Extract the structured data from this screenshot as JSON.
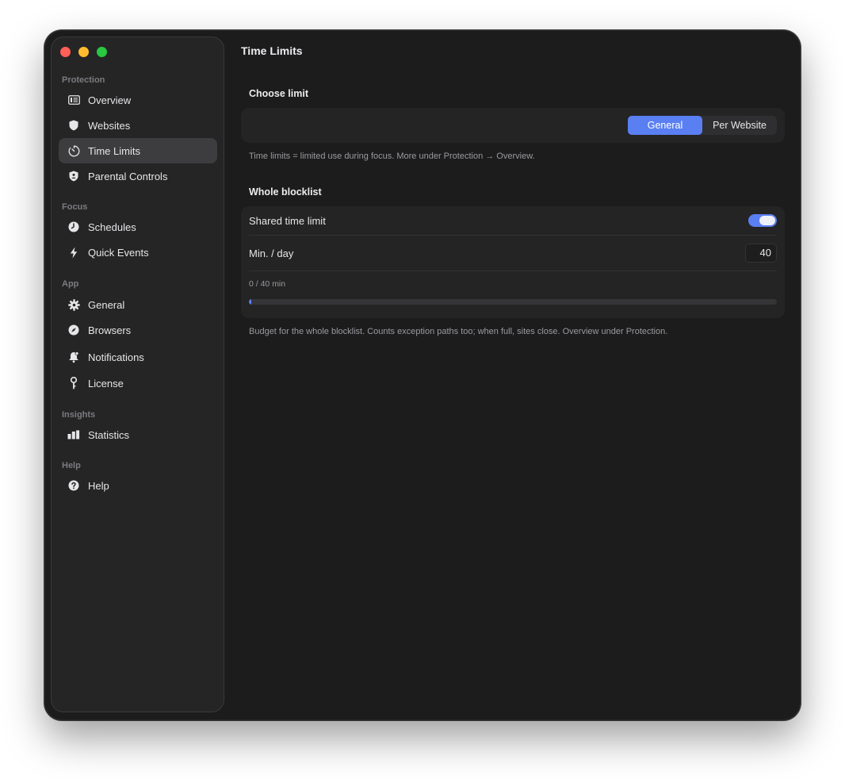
{
  "window": {
    "title": "Time Limits"
  },
  "sidebar": {
    "sections": [
      {
        "label": "Protection",
        "items": [
          {
            "label": "Overview",
            "icon": "overview-icon"
          },
          {
            "label": "Websites",
            "icon": "shield-icon"
          },
          {
            "label": "Time Limits",
            "icon": "timer-icon",
            "selected": true
          },
          {
            "label": "Parental Controls",
            "icon": "parental-shield-icon"
          }
        ]
      },
      {
        "label": "Focus",
        "items": [
          {
            "label": "Schedules",
            "icon": "clock-icon"
          },
          {
            "label": "Quick Events",
            "icon": "bolt-icon"
          }
        ]
      },
      {
        "label": "App",
        "items": [
          {
            "label": "General",
            "icon": "gear-icon"
          },
          {
            "label": "Browsers",
            "icon": "compass-icon"
          },
          {
            "label": "Notifications",
            "icon": "bell-icon"
          },
          {
            "label": "License",
            "icon": "key-icon"
          }
        ]
      },
      {
        "label": "Insights",
        "items": [
          {
            "label": "Statistics",
            "icon": "bar-chart-icon"
          }
        ]
      },
      {
        "label": "Help",
        "items": [
          {
            "label": "Help",
            "icon": "question-icon"
          }
        ]
      }
    ]
  },
  "choose_limit": {
    "title": "Choose limit",
    "options": [
      "General",
      "Per Website"
    ],
    "selected": "General",
    "note": "Time limits = limited use during focus. More under Protection → Overview."
  },
  "blocklist": {
    "title": "Whole blocklist",
    "shared_label": "Shared time limit",
    "shared_enabled": true,
    "min_label": "Min. / day",
    "min_value": "40",
    "usage_text": "0 / 40 min",
    "used_fraction": 0.0,
    "note": "Budget for the whole blocklist. Counts exception paths too; when full, sites close. Overview under Protection."
  },
  "colors": {
    "accent": "#5a7ff2",
    "window_bg": "#1c1c1d",
    "sidebar_bg": "#252526"
  }
}
